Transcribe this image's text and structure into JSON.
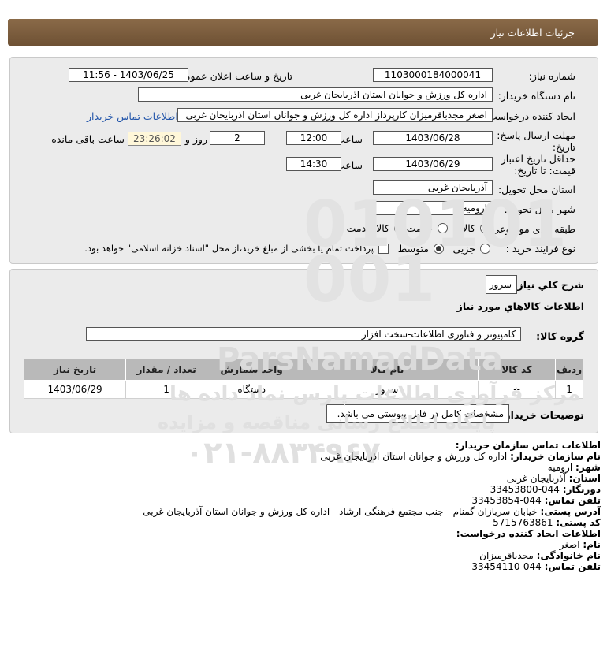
{
  "header": {
    "title": "جزئیات اطلاعات نیاز"
  },
  "form": {
    "need_number_label": "شماره نیاز:",
    "need_number": "1103000184000041",
    "announce_label": "تاریخ و ساعت اعلان عمومی:",
    "announce_value": "1403/06/25 - 11:56",
    "buyer_org_label": "نام دستگاه خریدار:",
    "buyer_org": "اداره کل ورزش و جوانان استان اذربایجان غربی",
    "creator_label": "ایجاد کننده درخواست:",
    "creator": "اصغر مجدباقرمیزان کارپرداز اداره کل ورزش و جوانان استان اذربایجان غربی",
    "contact_link": "اطلاعات تماس خریدار",
    "deadline_label_1": "مهلت ارسال پاسخ: تا",
    "deadline_label_2": "تاریخ:",
    "deadline_date": "1403/06/28",
    "time_label": "ساعت",
    "deadline_time": "12:00",
    "days_value": "2",
    "days_label": "روز و",
    "remaining_time": "23:26:02",
    "remaining_label": "ساعت باقی مانده",
    "validity_label_1": "حداقل تاریخ اعتبار",
    "validity_label_2": "قیمت: تا تاریخ:",
    "validity_date": "1403/06/29",
    "validity_time": "14:30",
    "province_label": "استان محل تحویل:",
    "province": "آذربایجان غربی",
    "city_label": "شهر محل تحویل:",
    "city": "ارومیه",
    "category_label": "طبقه بندی موضوعی:",
    "category_options": [
      "کالا",
      "خدمت",
      "کالا/خدمت"
    ],
    "process_label": "نوع فرآیند خرید :",
    "process_options": [
      "جزیی",
      "متوسط"
    ],
    "treasury_text": "پرداخت تمام یا بخشی از مبلغ خرید،از محل \"اسناد خزانه اسلامی\" خواهد بود."
  },
  "summary": {
    "general_label": "شرح کلي نياز:",
    "general_value": "سرور",
    "goods_info_title": "اطلاعات کالاهاي مورد نياز",
    "group_label": "گروه کالا:",
    "group_value": "کامپیوتر و فناوری اطلاعات-سخت افزار",
    "table": {
      "headers": [
        "ردیف",
        "کد کالا",
        "نام کالا",
        "واحد شمارش",
        "تعداد / مقدار",
        "تاریخ نیاز"
      ],
      "rows": [
        [
          "1",
          "--",
          "سرور",
          "دستگاه",
          "1",
          "1403/06/29"
        ]
      ]
    },
    "buyer_notes_label": "توضیحات خریدار:",
    "buyer_notes": "مشخصات کامل در فایل پیوستی می باشد."
  },
  "contact": {
    "title": "اطلاعات تماس سازمان خریدار:",
    "org_label": "نام سازمان خریدار:",
    "org": "اداره کل ورزش و جوانان استان اذربایجان غربی",
    "city_label": "شهر:",
    "city": "ارومیه",
    "province_label": "استان:",
    "province": "آذربایجان غربی",
    "fax_label": "دورنگار:",
    "fax": "044-33453800",
    "phone_label": "تلفن تماس:",
    "phone": "044-33453854",
    "address_label": "آدرس پستی:",
    "address": "خیابان سربازان گمنام - جنب مجتمع فرهنگی ارشاد - اداره کل ورزش و جوانان استان آذربایجان غربی",
    "postal_label": "کد پستی:",
    "postal": "5715763861",
    "requester_title": "اطلاعات ایجاد کننده درخواست:",
    "name_label": "نام:",
    "name": "اصغر",
    "family_label": "نام خانوادگی:",
    "family": "مجدباقرمیزان",
    "req_phone_label": "تلفن تماس:",
    "req_phone": "044-33454110"
  },
  "watermark": {
    "brand": "ParsNamadData",
    "line1": "مرکز فرآوری اطلاعات پارس نماد داده ها",
    "line2": "پایگاه اطلاع رسانی مناقصه و مزایده",
    "phone": "۰۲۱-۸۸۳۴۹۶۷۰"
  }
}
